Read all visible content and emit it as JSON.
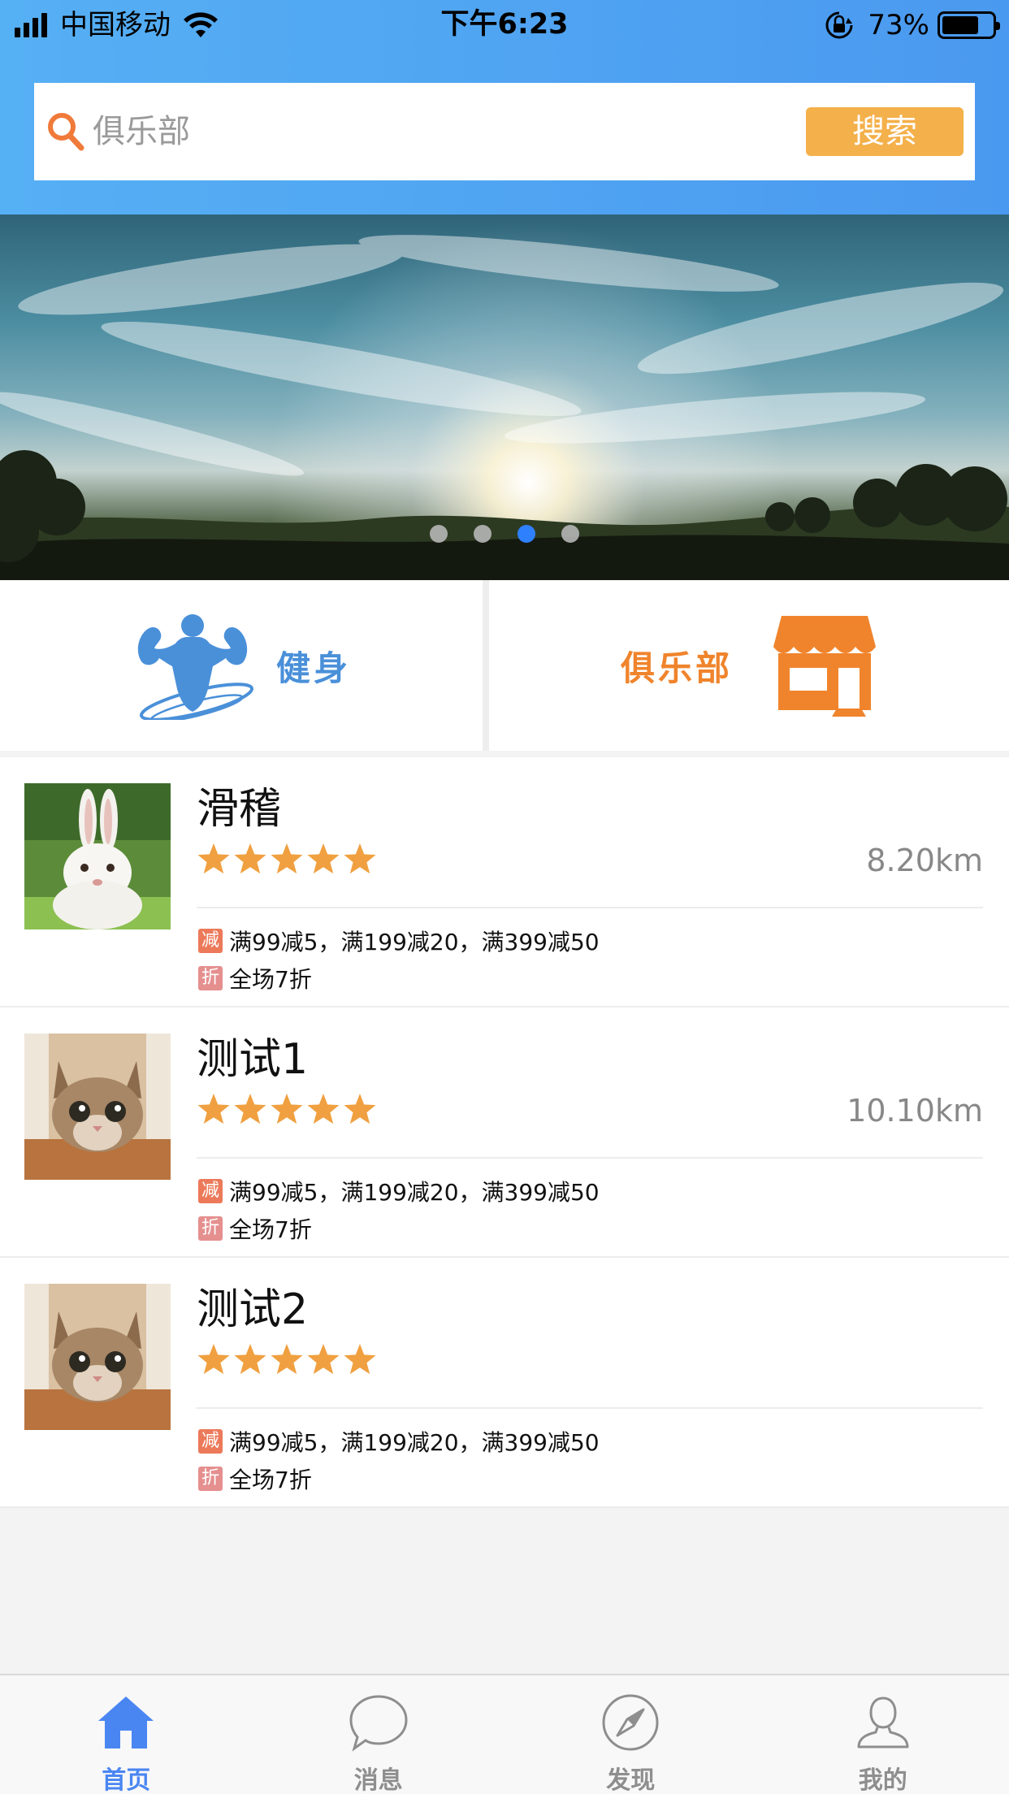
{
  "status_bar": {
    "carrier": "中国移动",
    "time": "下午6:23",
    "battery_percent": "73%",
    "battery_level": 0.73,
    "signal_bars": 4
  },
  "search": {
    "placeholder": "俱乐部",
    "button_label": "搜索"
  },
  "banner": {
    "page_count": 4,
    "active_page": 3
  },
  "categories": [
    {
      "label": "健身",
      "icon": "bodybuilder-icon",
      "color": "#4a90d9"
    },
    {
      "label": "俱乐部",
      "icon": "storefront-icon",
      "color": "#f0842c"
    }
  ],
  "clubs": [
    {
      "name": "滑稽",
      "rating": 5,
      "distance": "8.20km",
      "thumbnail": "rabbit",
      "promos": [
        {
          "tag": "减",
          "text": "满99减5，满199减20，满399减50"
        },
        {
          "tag": "折",
          "text": "全场7折"
        }
      ]
    },
    {
      "name": "测试1",
      "rating": 5,
      "distance": "10.10km",
      "thumbnail": "cat",
      "promos": [
        {
          "tag": "减",
          "text": "满99减5，满199减20，满399减50"
        },
        {
          "tag": "折",
          "text": "全场7折"
        }
      ]
    },
    {
      "name": "测试2",
      "rating": 5,
      "distance": "",
      "thumbnail": "cat",
      "promos": [
        {
          "tag": "减",
          "text": "满99减5，满199减20，满399减50"
        },
        {
          "tag": "折",
          "text": "全场7折"
        }
      ]
    }
  ],
  "tabbar": {
    "tabs": [
      {
        "label": "首页",
        "icon": "home-icon",
        "active": true
      },
      {
        "label": "消息",
        "icon": "chat-bubble-icon",
        "active": false
      },
      {
        "label": "发现",
        "icon": "compass-icon",
        "active": false
      },
      {
        "label": "我的",
        "icon": "person-icon",
        "active": false
      }
    ]
  },
  "colors": {
    "header_blue": "#4a99f0",
    "accent_orange": "#f4b04a",
    "star_orange": "#f0a040",
    "active_tab_blue": "#4a86f2",
    "fitness_blue": "#4a90d9",
    "club_orange": "#f0842c"
  }
}
